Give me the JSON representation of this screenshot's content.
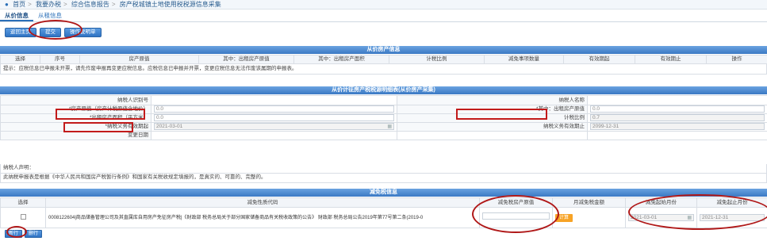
{
  "breadcrumb": [
    "首页",
    "我要办税",
    "综合信息报告",
    "房产税城镇土地使用税税源信息采集"
  ],
  "tabs": [
    {
      "label": "从价信息"
    },
    {
      "label": "从租信息"
    }
  ],
  "toolbar": {
    "home": "返回主页",
    "submit": "提交",
    "print": "操作说明单"
  },
  "section1": {
    "title": "从价房产信息",
    "columns": [
      "选择",
      "序号",
      "房产原值",
      "其中：出租房产原值",
      "其中：出租房产面积",
      "计税比例",
      "减免事项数量",
      "有效期起",
      "有效期止",
      "操作"
    ],
    "hint": "提示：应税信息已申报未开票，请先作废申报再变更应税信息。应税信息已申报并开票，变更应税信息无法作废该属期的申报表。"
  },
  "section2": {
    "title": "从价计征房产税税源明细表(从价房产采集)",
    "taxpayer_id_label": "纳税人识别号",
    "taxpayer_name_label": "纳税人名称",
    "original_value_label": "*房产原值（房产计税原值含地价）",
    "original_value": "0.0",
    "rent_value_label": "*其中：出租房产原值",
    "rent_value": "0.0",
    "rent_area_label": "*出租房产面积（平方米）",
    "rent_area": "0.0",
    "tax_ratio_label": "计税比例",
    "tax_ratio": "0.7",
    "start_label": "*纳税义务有效期起",
    "start_value": "2021-03-01",
    "end_label": "纳税义务有效期止",
    "end_value": "2099-12-31",
    "change_date_label": "变更日期",
    "declarant_label": "纳税人声明：",
    "declaration": "此纳税申报表是根据《中华人民共和国房产税暂行条例》和国家有关税收规定填报的，是真实的、可靠的、完整的。"
  },
  "section3": {
    "title": "减免税信息",
    "columns": [
      "选择",
      "减免性质代码",
      "减免税房产原值",
      "月减免税金额",
      "减免起始月份",
      "减免起止月份"
    ],
    "row": {
      "code": "0008122604|商品储备管理公司及其直属库自用房产免征房产税|《财政部 税务总局关于部分国家储备商品有关税收政策的公告》 财政部 税务总局公告2019年第77号第二条(2019-0",
      "orig_value": "",
      "calc_button": "计算",
      "start": "2021-03-01",
      "end": "2021-12-31"
    }
  },
  "footer": {
    "add": "新行",
    "delete": "删行"
  },
  "colors": {
    "header_blue": "#3b79c4",
    "mark_red": "#c21b1b",
    "accent_orange": "#f7a325"
  }
}
